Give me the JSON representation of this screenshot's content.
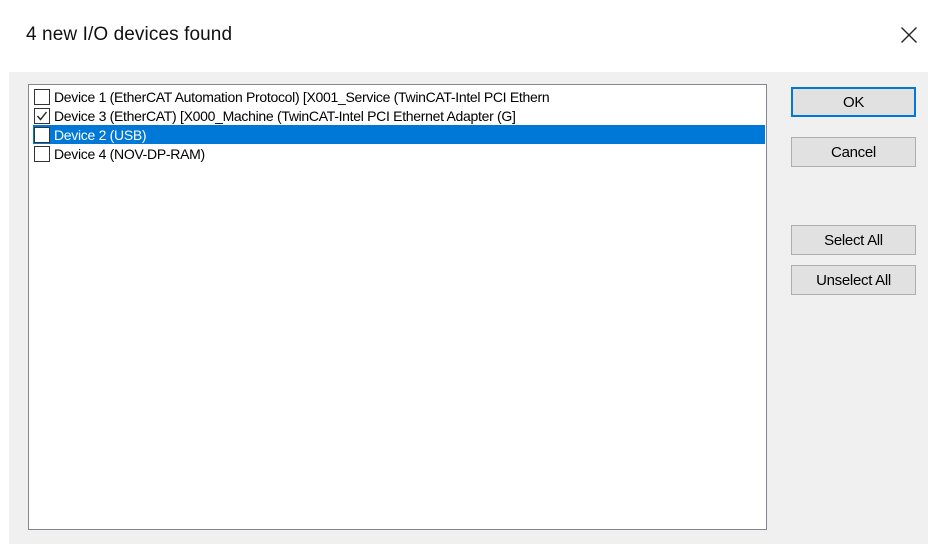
{
  "dialog": {
    "title": "4 new I/O devices found",
    "close_icon": "close-icon"
  },
  "devices": [
    {
      "label": "Device 1 (EtherCAT Automation Protocol)     [X001_Service (TwinCAT-Intel PCI Ethern",
      "checked": false,
      "selected": false
    },
    {
      "label": "Device 3 (EtherCAT)     [X000_Machine (TwinCAT-Intel PCI Ethernet Adapter (G]",
      "checked": true,
      "selected": false
    },
    {
      "label": "Device 2 (USB)",
      "checked": false,
      "selected": true
    },
    {
      "label": "Device 4 (NOV-DP-RAM)",
      "checked": false,
      "selected": false
    }
  ],
  "buttons": {
    "ok": "OK",
    "cancel": "Cancel",
    "select_all": "Select All",
    "unselect_all": "Unselect All"
  },
  "colors": {
    "selection": "#0078d7",
    "default_button_border": "#0078d7",
    "dialog_background": "#f0f0f0"
  }
}
